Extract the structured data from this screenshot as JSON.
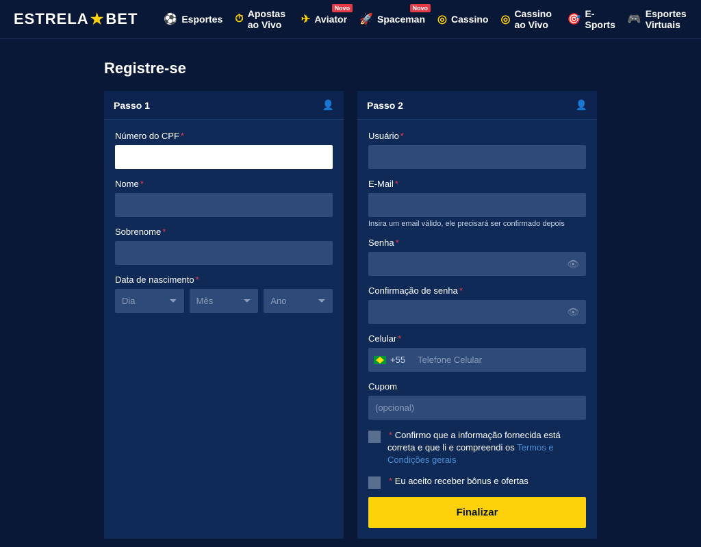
{
  "logo": {
    "part1": "ESTRELA",
    "part2": "BET"
  },
  "nav": [
    {
      "label": "Esportes",
      "icon": "⚽"
    },
    {
      "label": "Apostas ao Vivo",
      "icon": "⏱"
    },
    {
      "label": "Aviator",
      "icon": "✈",
      "badge": "Novo"
    },
    {
      "label": "Spaceman",
      "icon": "🚀",
      "badge": "Novo"
    },
    {
      "label": "Cassino",
      "icon": "◎"
    },
    {
      "label": "Cassino ao Vivo",
      "icon": "◎"
    },
    {
      "label": "E-Sports",
      "icon": "🎯"
    },
    {
      "label": "Esportes Virtuais",
      "icon": "🎮"
    }
  ],
  "page_title": "Registre-se",
  "step1": {
    "title": "Passo 1",
    "cpf_label": "Número do CPF",
    "name_label": "Nome",
    "surname_label": "Sobrenome",
    "dob_label": "Data de nascimento",
    "day": "Dia",
    "month": "Mês",
    "year": "Ano"
  },
  "step2": {
    "title": "Passo 2",
    "user_label": "Usuário",
    "email_label": "E-Mail",
    "email_hint": "Insira um email válido, ele precisará ser confirmado depois",
    "password_label": "Senha",
    "confirm_label": "Confirmação de senha",
    "phone_label": "Celular",
    "phone_prefix": "+55",
    "phone_placeholder": "Telefone Celular",
    "coupon_label": "Cupom",
    "coupon_placeholder": "(opcional)",
    "confirm_text": "Confirmo que a informação fornecida está correta e que li e compreendi os ",
    "terms_link": "Termos e Condições gerais",
    "bonus_text": "Eu aceito receber bônus e ofertas",
    "submit": "Finalizar"
  }
}
